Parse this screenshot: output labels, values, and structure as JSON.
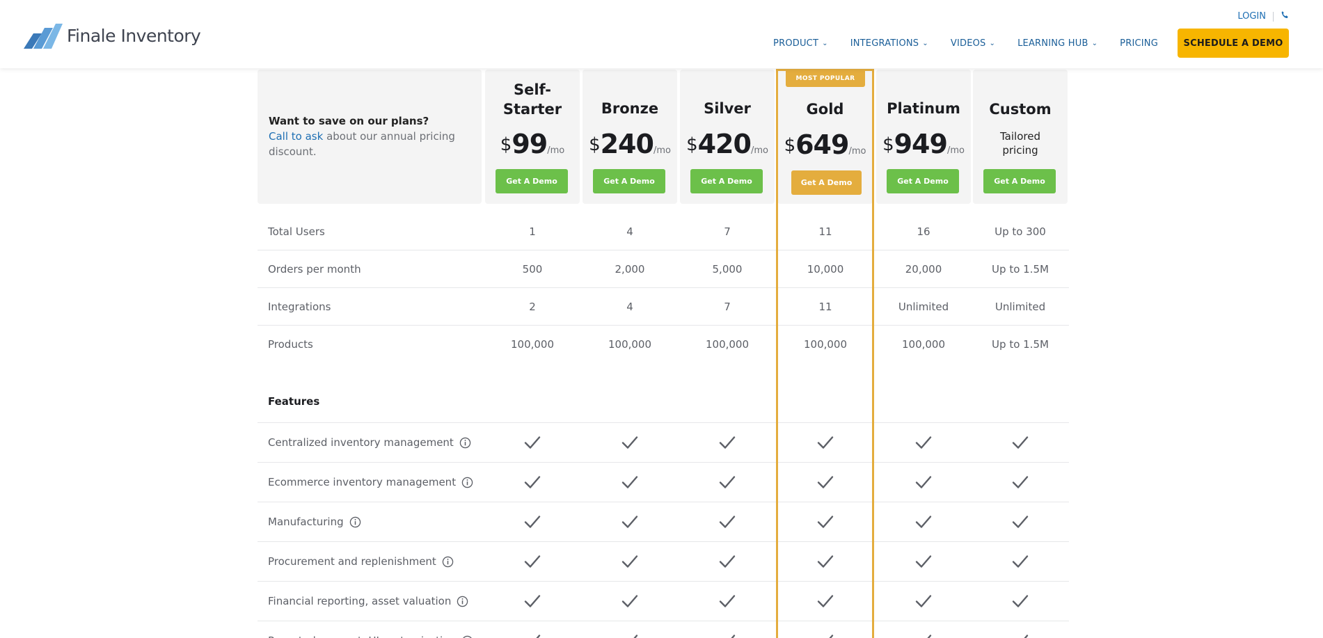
{
  "header": {
    "brand": "Finale Inventory",
    "login": "LOGIN",
    "nav": [
      {
        "label": "PRODUCT",
        "dropdown": true
      },
      {
        "label": "INTEGRATIONS",
        "dropdown": true
      },
      {
        "label": "VIDEOS",
        "dropdown": true
      },
      {
        "label": "LEARNING HUB",
        "dropdown": true
      },
      {
        "label": "PRICING",
        "dropdown": false
      }
    ],
    "cta": "SCHEDULE A DEMO"
  },
  "promo": {
    "title": "Want to save on our plans?",
    "link": "Call to ask",
    "rest": "about our annual pricing discount."
  },
  "badge": "MOST POPULAR",
  "plans": [
    {
      "name_line1": "Self-",
      "name_line2": "Starter",
      "currency": "$",
      "price": "99",
      "per": "/mo",
      "button": "Get A Demo"
    },
    {
      "name_line1": "Bronze",
      "name_line2": "",
      "currency": "$",
      "price": "240",
      "per": "/mo",
      "button": "Get A Demo"
    },
    {
      "name_line1": "Silver",
      "name_line2": "",
      "currency": "$",
      "price": "420",
      "per": "/mo",
      "button": "Get A Demo"
    },
    {
      "name_line1": "Gold",
      "name_line2": "",
      "currency": "$",
      "price": "649",
      "per": "/mo",
      "button": "Get A Demo"
    },
    {
      "name_line1": "Platinum",
      "name_line2": "",
      "currency": "$",
      "price": "949",
      "per": "/mo",
      "button": "Get A Demo"
    },
    {
      "name_line1": "Custom",
      "name_line2": "",
      "tailored_line1": "Tailored",
      "tailored_line2": "pricing",
      "button": "Get A Demo"
    }
  ],
  "limits": [
    {
      "label": "Total Users",
      "values": [
        "1",
        "4",
        "7",
        "11",
        "16",
        "Up to 300"
      ]
    },
    {
      "label": "Orders per month",
      "values": [
        "500",
        "2,000",
        "5,000",
        "10,000",
        "20,000",
        "Up to 1.5M"
      ]
    },
    {
      "label": "Integrations",
      "values": [
        "2",
        "4",
        "7",
        "11",
        "Unlimited",
        "Unlimited"
      ]
    },
    {
      "label": "Products",
      "values": [
        "100,000",
        "100,000",
        "100,000",
        "100,000",
        "100,000",
        "Up to 1.5M"
      ]
    }
  ],
  "features_title": "Features",
  "features": [
    "Centralized inventory management",
    "Ecommerce inventory management",
    "Manufacturing",
    "Procurement and replenishment",
    "Financial reporting, asset valuation",
    "Report, document, UI customization"
  ],
  "colors": {
    "brand_blue": "#1e6fb3",
    "cta_yellow": "#f7b500",
    "green": "#6cc04a",
    "gold": "#e4ad3e"
  }
}
